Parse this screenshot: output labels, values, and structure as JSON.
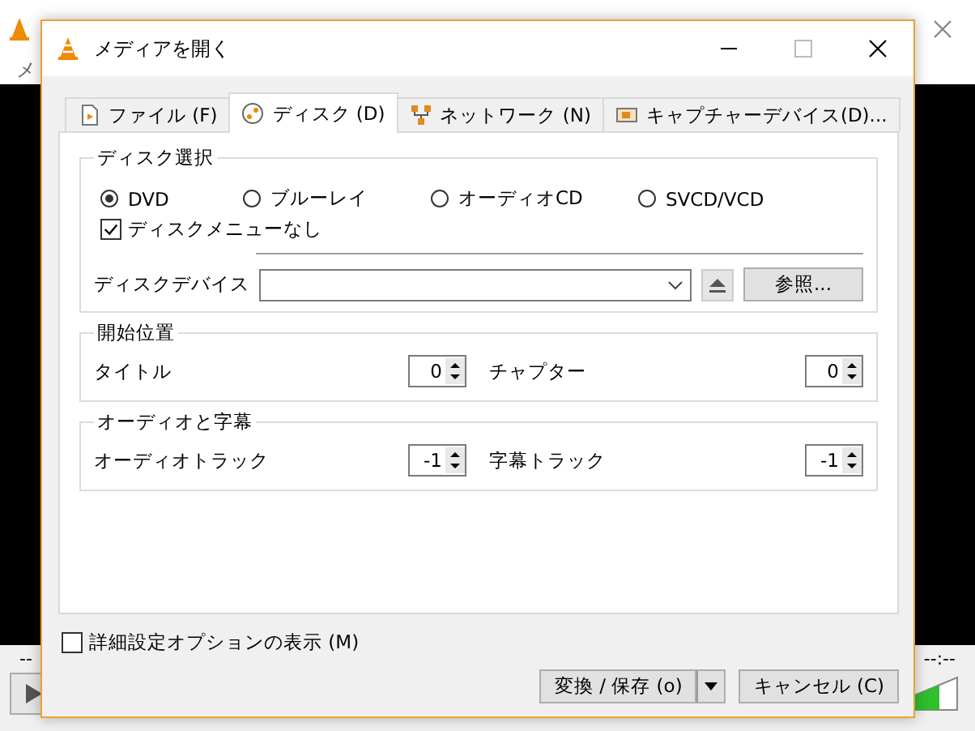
{
  "background_window": {
    "menu_fragment": "メ",
    "time_left": "--",
    "time_right": "--:--"
  },
  "dialog": {
    "title": "メディアを開く"
  },
  "tabs": [
    {
      "label": "ファイル (F)",
      "kind": "file",
      "selected": false
    },
    {
      "label": "ディスク (D)",
      "kind": "disc",
      "selected": true
    },
    {
      "label": "ネットワーク (N)",
      "kind": "network",
      "selected": false
    },
    {
      "label": "キャプチャーデバイス(D)...",
      "kind": "capture",
      "selected": false
    }
  ],
  "disc_selection": {
    "title": "ディスク選択",
    "options": [
      {
        "label": "DVD",
        "selected": true
      },
      {
        "label": "ブルーレイ",
        "selected": false
      },
      {
        "label": "オーディオCD",
        "selected": false
      },
      {
        "label": "SVCD/VCD",
        "selected": false
      }
    ],
    "no_menu": {
      "label": "ディスクメニューなし",
      "checked": true
    },
    "device_label": "ディスクデバイス",
    "browse": "参照..."
  },
  "start_position": {
    "title": "開始位置",
    "fields": [
      {
        "label": "タイトル",
        "value": "0"
      },
      {
        "label": "チャプター",
        "value": "0"
      }
    ]
  },
  "audio_subtitles": {
    "title": "オーディオと字幕",
    "fields": [
      {
        "label": "オーディオトラック",
        "value": "-1"
      },
      {
        "label": "字幕トラック",
        "value": "-1"
      }
    ]
  },
  "advanced": {
    "label": "詳細設定オプションの表示 (M)",
    "checked": false
  },
  "buttons": [
    {
      "label": "変換 / 保存 (o)",
      "kind": "split"
    },
    {
      "label": "キャンセル (C)",
      "kind": "plain"
    }
  ]
}
